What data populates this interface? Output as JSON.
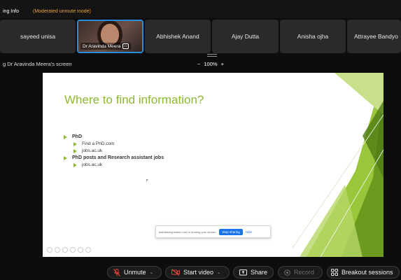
{
  "topbar": {
    "meeting_info": "ing Info",
    "mode": "(Moderated unmute mode)"
  },
  "participants": [
    {
      "name": "sayeed unisa"
    },
    {
      "name": "Dr Aravinda Meera",
      "active": true
    },
    {
      "name": "Abhishek Anand"
    },
    {
      "name": "Ajay Dutta"
    },
    {
      "name": "Anisha ojha"
    },
    {
      "name": "Attrayee Bandyo"
    }
  ],
  "share": {
    "label": "g Dr Aravinda Meera's screen",
    "zoom_out": "−",
    "zoom_level": "100%",
    "zoom_in": "+"
  },
  "slide": {
    "title": "Where to find information?",
    "bullets": [
      {
        "level": 1,
        "text": "PhD"
      },
      {
        "level": 2,
        "text": "Find a PhD.com"
      },
      {
        "level": 2,
        "text": "jobs.ac.uk"
      },
      {
        "level": 1,
        "text": "PhD posts and Research assistant jobs"
      },
      {
        "level": 2,
        "text": "jobs.ac.uk"
      }
    ],
    "accent_color": "#8dbb30"
  },
  "share_notice": {
    "message": "ipatnilavsig.webex.com is sharing your screen.",
    "stop_label": "Stop sharing",
    "hide_label": "Hide"
  },
  "controls": {
    "unmute": "Unmute",
    "start_video": "Start video",
    "share": "Share",
    "record": "Record",
    "breakout": "Breakout sessions"
  },
  "colors": {
    "accent_mode": "#e8a23a",
    "active_border": "#2b8cd8",
    "muted_icon": "#e0453a"
  }
}
